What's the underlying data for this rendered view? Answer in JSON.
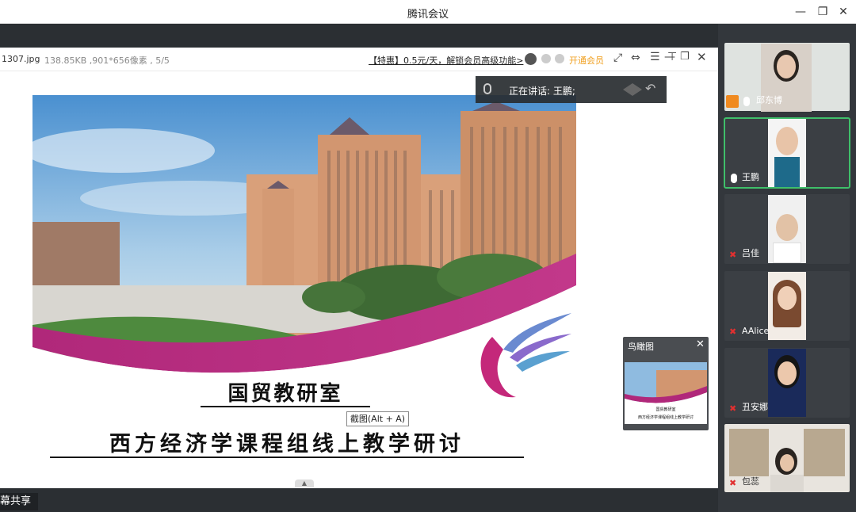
{
  "window": {
    "title": "腾讯会议"
  },
  "viewer": {
    "filename": "1307.jpg",
    "fileinfo": "138.85KB ,901*656像素 , 5/5",
    "promo": "【特惠】0.5元/天，解锁会员高级功能>",
    "vip": "开通会员"
  },
  "speaker": {
    "text": "正在讲话: 王鹏;"
  },
  "slide": {
    "title1": "国贸教研室",
    "title2": "西方经济学课程组线上教学研讨"
  },
  "tooltip": {
    "text": "截图(Alt + A)"
  },
  "birdseye": {
    "title": "鸟瞰图",
    "caption1": "国贸教研室",
    "caption2": "西方经济学课程组线上教学研讨"
  },
  "share_label": "幕共享",
  "participants": [
    {
      "name": "邱东博"
    },
    {
      "name": "王鹏"
    },
    {
      "name": "吕佳"
    },
    {
      "name": "AAlice"
    },
    {
      "name": "丑安娜"
    },
    {
      "name": "包蕊"
    }
  ],
  "colors": {
    "accent": "#3fbf6a",
    "vip": "#f0a020",
    "magenta": "#b0287a"
  }
}
